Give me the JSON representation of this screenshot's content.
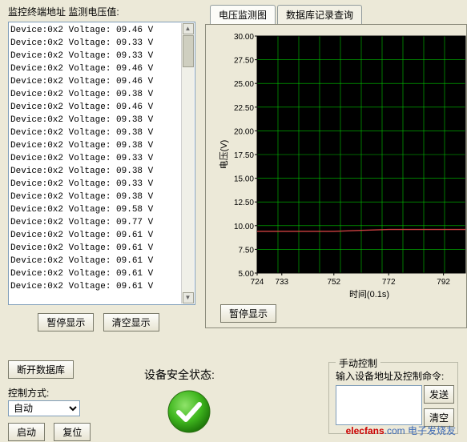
{
  "left": {
    "label": "监控终端地址 监测电压值:",
    "log_entries": [
      "Device:0x2 Voltage: 09.46 V",
      "Device:0x2 Voltage: 09.33 V",
      "Device:0x2 Voltage: 09.33 V",
      "Device:0x2 Voltage: 09.46 V",
      "Device:0x2 Voltage: 09.46 V",
      "Device:0x2 Voltage: 09.38 V",
      "Device:0x2 Voltage: 09.46 V",
      "Device:0x2 Voltage: 09.38 V",
      "Device:0x2 Voltage: 09.38 V",
      "Device:0x2 Voltage: 09.38 V",
      "Device:0x2 Voltage: 09.33 V",
      "Device:0x2 Voltage: 09.38 V",
      "Device:0x2 Voltage: 09.33 V",
      "Device:0x2 Voltage: 09.38 V",
      "Device:0x2 Voltage: 09.58 V",
      "Device:0x2 Voltage: 09.77 V",
      "Device:0x2 Voltage: 09.61 V",
      "Device:0x2 Voltage: 09.61 V",
      "Device:0x2 Voltage: 09.61 V",
      "Device:0x2 Voltage: 09.61 V",
      "Device:0x2 Voltage: 09.61 V"
    ],
    "pause_btn": "暂停显示",
    "clear_btn": "清空显示"
  },
  "tabs": {
    "chart": "电压监测图",
    "db": "数据库记录查询"
  },
  "chart_data": {
    "type": "line",
    "ylabel": "电压(V)",
    "xlabel": "时间(0.1s)",
    "yticks": [
      5.0,
      7.5,
      10.0,
      12.5,
      15.0,
      17.5,
      20.0,
      22.5,
      25.0,
      27.5,
      30.0
    ],
    "xticks": [
      724,
      733,
      752,
      772,
      792
    ],
    "xlim": [
      724,
      800
    ],
    "ylim": [
      5.0,
      30.0
    ],
    "series": [
      {
        "name": "voltage",
        "color": "#cc4040",
        "x": [
          724,
          733,
          742,
          752,
          762,
          772,
          782,
          792,
          800
        ],
        "y": [
          9.4,
          9.4,
          9.4,
          9.4,
          9.5,
          9.6,
          9.6,
          9.6,
          9.6
        ]
      }
    ],
    "grid": true,
    "grid_color": "#00c800",
    "bg": "#000000"
  },
  "chart": {
    "pause_btn": "暂停显示"
  },
  "bottom": {
    "disconnect_db": "断开数据库",
    "ctrl_label": "控制方式:",
    "ctrl_value": "自动",
    "start_btn": "启动",
    "reset_btn": "复位",
    "status_label": "设备安全状态:",
    "manual_legend": "手动控制",
    "manual_inner": "输入设备地址及控制命令:",
    "send_btn": "发送",
    "clear_btn": "清空"
  },
  "watermark": {
    "red": "elecfans",
    "blue": ".com 电子发烧友"
  }
}
